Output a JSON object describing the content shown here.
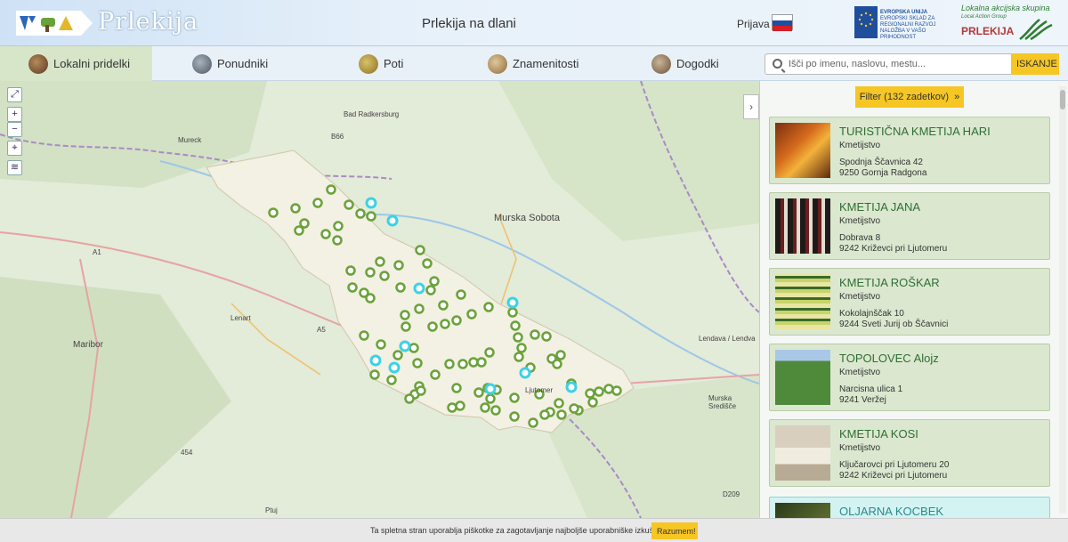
{
  "header": {
    "brand": "Prlekija",
    "subtitle": "Prlekija na dlani",
    "login_label": "Prijava",
    "eu_text": "EVROPSKA UNIJA",
    "eu_subtext": "EVROPSKI SKLAD ZA REGIONALNI RAZVOJ",
    "eu_subtext2": "NALOŽBA V VAŠO PRIHODNOST",
    "lag_top": "Lokalna akcijska skupina",
    "lag_sub": "Local Action Group",
    "lag_name": "PRLEKIJA"
  },
  "nav": {
    "items": [
      {
        "label": "Lokalni pridelki",
        "icon": "produce-icon",
        "active": true
      },
      {
        "label": "Ponudniki",
        "icon": "providers-icon"
      },
      {
        "label": "Poti",
        "icon": "paths-icon"
      },
      {
        "label": "Znamenitosti",
        "icon": "landmarks-icon"
      },
      {
        "label": "Dogodki",
        "icon": "events-icon"
      }
    ],
    "search_placeholder": "Išči po imenu, naslovu, mestu...",
    "search_button": "ISKANJE"
  },
  "map": {
    "labels": [
      "Bad Radkersburg",
      "Murska Sobota",
      "Mureck",
      "Lenart",
      "Maribor",
      "Ljutomer",
      "Lendava / Lendva",
      "Ptuj",
      "Murska Središče",
      "A1",
      "A5",
      "B66",
      "454",
      "D209"
    ],
    "accent_region": "#f3f0e4",
    "marker_color": "#6aa23a",
    "highlight_color": "#3ad2e6"
  },
  "sidebar": {
    "filter_label": "Filter (132 zadetkov)",
    "cards": [
      {
        "title": "TURISTIČNA KMETIJA HARI",
        "type": "Kmetijstvo",
        "addr1": "Spodnja Ščavnica 42",
        "addr2": "9250 Gornja Radgona"
      },
      {
        "title": "KMETIJA JANA",
        "type": "Kmetijstvo",
        "addr1": "Dobrava 8",
        "addr2": "9242 Križevci pri Ljutomeru"
      },
      {
        "title": "KMETIJA ROŠKAR",
        "type": "Kmetijstvo",
        "addr1": "Kokolajnščak 10",
        "addr2": "9244 Sveti Jurij ob Ščavnici"
      },
      {
        "title": "TOPOLOVEC Alojz",
        "type": "Kmetijstvo",
        "addr1": "Narcisna ulica 1",
        "addr2": "9241 Veržej"
      },
      {
        "title": "KMETIJA KOSI",
        "type": "Kmetijstvo",
        "addr1": "Ključarovci pri Ljutomeru 20",
        "addr2": "9242 Križevci pri Ljutomeru"
      },
      {
        "title": "OLJARNA KOCBEK",
        "type": "",
        "addr1": "",
        "addr2": ""
      }
    ]
  },
  "cookie": {
    "text": "Ta spletna stran uporablja piškotke za zagotavljanje najboljše uporabniške izkušnje",
    "button": "Razumem!"
  }
}
